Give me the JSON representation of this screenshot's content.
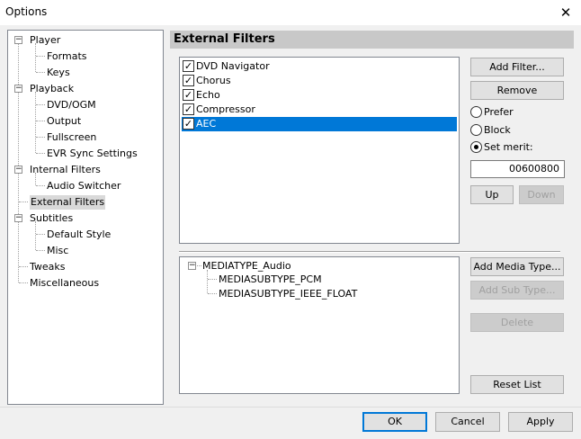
{
  "window": {
    "title": "Options",
    "close_glyph": "✕"
  },
  "tree": {
    "items": [
      {
        "label": "Player",
        "expander": "−"
      },
      {
        "label": "Formats"
      },
      {
        "label": "Keys"
      },
      {
        "label": "Playback",
        "expander": "−"
      },
      {
        "label": "DVD/OGM"
      },
      {
        "label": "Output"
      },
      {
        "label": "Fullscreen"
      },
      {
        "label": "EVR Sync Settings"
      },
      {
        "label": "Internal Filters",
        "expander": "−"
      },
      {
        "label": "Audio Switcher"
      },
      {
        "label": "External Filters",
        "selected": true
      },
      {
        "label": "Subtitles",
        "expander": "−"
      },
      {
        "label": "Default Style"
      },
      {
        "label": "Misc"
      },
      {
        "label": "Tweaks"
      },
      {
        "label": "Miscellaneous"
      }
    ]
  },
  "page": {
    "title": "External Filters"
  },
  "filters": {
    "items": [
      {
        "label": "DVD Navigator",
        "checked": true
      },
      {
        "label": "Chorus",
        "checked": true
      },
      {
        "label": "Echo",
        "checked": true
      },
      {
        "label": "Compressor",
        "checked": true
      },
      {
        "label": "AEC",
        "checked": true,
        "selected": true
      }
    ],
    "check_glyph": "✓"
  },
  "buttons": {
    "add_filter": "Add Filter...",
    "remove": "Remove",
    "up": "Up",
    "down": "Down",
    "add_media_type": "Add Media Type...",
    "add_sub_type": "Add Sub Type...",
    "delete": "Delete",
    "reset_list": "Reset List",
    "ok": "OK",
    "cancel": "Cancel",
    "apply": "Apply"
  },
  "merit_options": {
    "prefer": "Prefer",
    "block": "Block",
    "set_merit": "Set merit:",
    "selected": "set_merit",
    "merit_value": "00600800"
  },
  "media_types": {
    "root": {
      "label": "MEDIATYPE_Audio",
      "expander": "−"
    },
    "subtypes": [
      "MEDIASUBTYPE_PCM",
      "MEDIASUBTYPE_IEEE_FLOAT"
    ]
  },
  "colors": {
    "selection": "#0078d7",
    "header_band": "#c8c8c8",
    "disabled_text": "#a0a0a0"
  }
}
